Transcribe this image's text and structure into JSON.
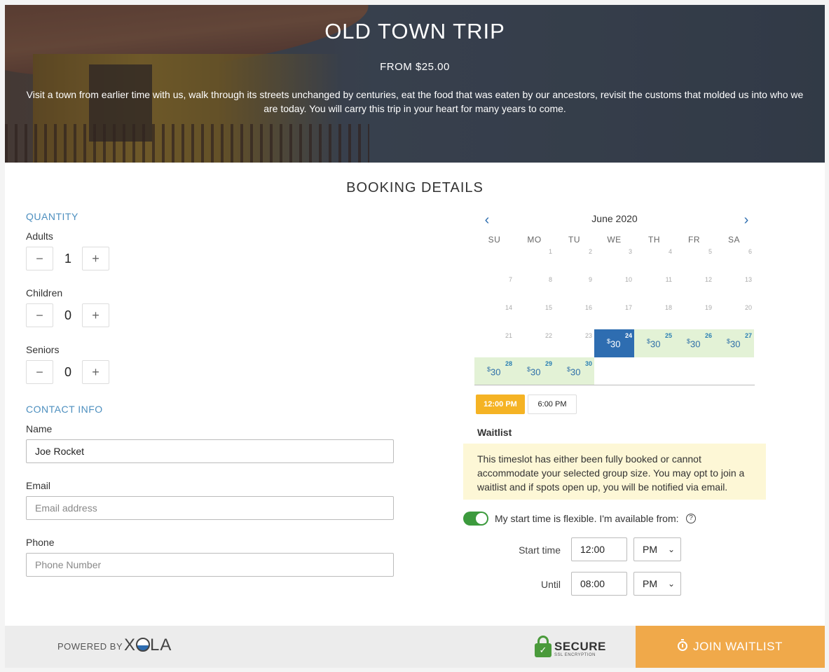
{
  "hero": {
    "title": "OLD TOWN TRIP",
    "price": "FROM $25.00",
    "description": "Visit a town from earlier time with us, walk through its streets unchanged by centuries, eat the food that was eaten by our ancestors, revisit the customs that molded us into who we are today. You will carry this trip in your heart for many years to come."
  },
  "booking": {
    "title": "BOOKING DETAILS"
  },
  "quantity": {
    "label": "QUANTITY",
    "adults": {
      "label": "Adults",
      "value": "1"
    },
    "children": {
      "label": "Children",
      "value": "0"
    },
    "seniors": {
      "label": "Seniors",
      "value": "0"
    },
    "minus": "−",
    "plus": "+"
  },
  "contact": {
    "label": "CONTACT INFO",
    "name": {
      "label": "Name",
      "value": "Joe Rocket",
      "placeholder": ""
    },
    "email": {
      "label": "Email",
      "value": "",
      "placeholder": "Email address"
    },
    "phone": {
      "label": "Phone",
      "value": "",
      "placeholder": "Phone Number"
    }
  },
  "calendar": {
    "month": "June 2020",
    "prev": "‹",
    "next": "›",
    "weekdays": [
      "SU",
      "MO",
      "TU",
      "WE",
      "TH",
      "FR",
      "SA"
    ],
    "days": [
      {
        "n": "1",
        "state": "off"
      },
      {
        "n": "2",
        "state": "off"
      },
      {
        "n": "3",
        "state": "off"
      },
      {
        "n": "4",
        "state": "off"
      },
      {
        "n": "5",
        "state": "off"
      },
      {
        "n": "6",
        "state": "off"
      },
      {
        "n": "7",
        "state": "off"
      },
      {
        "n": "8",
        "state": "off"
      },
      {
        "n": "9",
        "state": "off"
      },
      {
        "n": "10",
        "state": "off"
      },
      {
        "n": "11",
        "state": "off"
      },
      {
        "n": "12",
        "state": "off"
      },
      {
        "n": "13",
        "state": "off"
      },
      {
        "n": "14",
        "state": "off"
      },
      {
        "n": "15",
        "state": "off"
      },
      {
        "n": "16",
        "state": "off"
      },
      {
        "n": "17",
        "state": "off"
      },
      {
        "n": "18",
        "state": "off"
      },
      {
        "n": "19",
        "state": "off"
      },
      {
        "n": "20",
        "state": "off"
      },
      {
        "n": "21",
        "state": "off"
      },
      {
        "n": "22",
        "state": "off"
      },
      {
        "n": "23",
        "state": "off"
      },
      {
        "n": "24",
        "state": "sel",
        "price": "30"
      },
      {
        "n": "25",
        "state": "avail",
        "price": "30"
      },
      {
        "n": "26",
        "state": "avail",
        "price": "30"
      },
      {
        "n": "27",
        "state": "avail",
        "price": "30"
      },
      {
        "n": "28",
        "state": "avail",
        "price": "30"
      },
      {
        "n": "29",
        "state": "avail",
        "price": "30"
      },
      {
        "n": "30",
        "state": "avail",
        "price": "30"
      }
    ],
    "currency": "$"
  },
  "times": {
    "slot1": "12:00 PM",
    "slot2": "6:00 PM"
  },
  "waitlist": {
    "title": "Waitlist",
    "message": "This timeslot has either been fully booked or cannot accommodate your selected group size. You may opt to join a waitlist and if spots open up, you will be notified via email."
  },
  "flexible": {
    "label": "My start time is flexible. I'm available from:",
    "help": "?",
    "start_label": "Start time",
    "start_value": "12:00",
    "start_ampm": "PM",
    "until_label": "Until",
    "until_value": "08:00",
    "until_ampm": "PM",
    "chevron": "⌄"
  },
  "footer": {
    "powered_by": "POWERED BY",
    "logo_x": "X",
    "logo_rest": "LA",
    "secure": "SECURE",
    "secure_sub": "SSL ENCRYPTION",
    "lock_mark": "✓",
    "join": "JOIN WAITLIST"
  },
  "colors": {
    "accent": "#2e6db1",
    "available": "#e3f2d6",
    "slot_active": "#f5b324",
    "join": "#f0a94a",
    "toggle_on": "#3c9a3d"
  }
}
